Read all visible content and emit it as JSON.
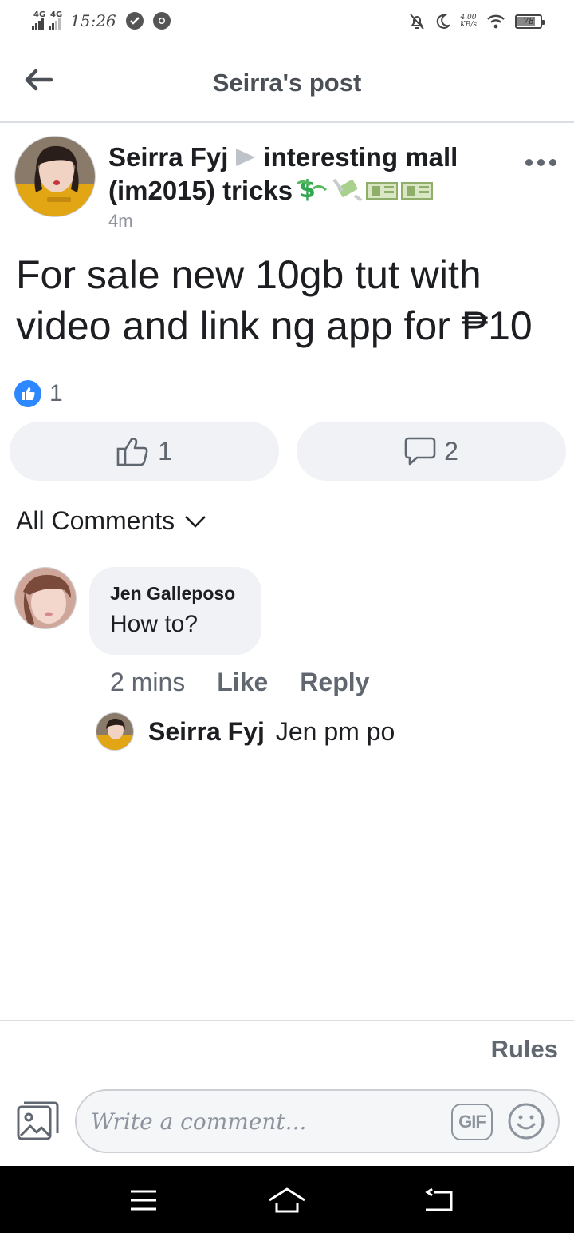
{
  "status_bar": {
    "network_1": "4G",
    "network_2": "4G",
    "time": "15:26",
    "speed_value": "4.00",
    "speed_unit": "KB/s",
    "battery_percent": "78",
    "battery_level": 0.78
  },
  "header": {
    "title": "Seirra's post"
  },
  "post": {
    "author": "Seirra Fyj",
    "group": "interesting mall (im2015) tricks",
    "group_emojis": [
      "money-bag-icon",
      "money-wings-icon",
      "banknote-icon",
      "banknote-icon"
    ],
    "time": "4m",
    "text": "For sale new 10gb tut with video and link ng app for ₱10",
    "reaction_count": "1",
    "like_count": "1",
    "comment_count": "2"
  },
  "comments": {
    "filter_label": "All Comments",
    "items": [
      {
        "author": "Jen Galleposo",
        "text": "How to?",
        "time": "2 mins",
        "like_label": "Like",
        "reply_label": "Reply",
        "reply": {
          "author": "Seirra Fyj",
          "text": "Jen pm po"
        }
      }
    ]
  },
  "composer": {
    "rules_label": "Rules",
    "placeholder": "Write a comment...",
    "gif_label": "GIF"
  },
  "colors": {
    "accent_blue": "#2d88ff",
    "pill_bg": "#f0f2f5",
    "secondary_text": "#606770"
  }
}
